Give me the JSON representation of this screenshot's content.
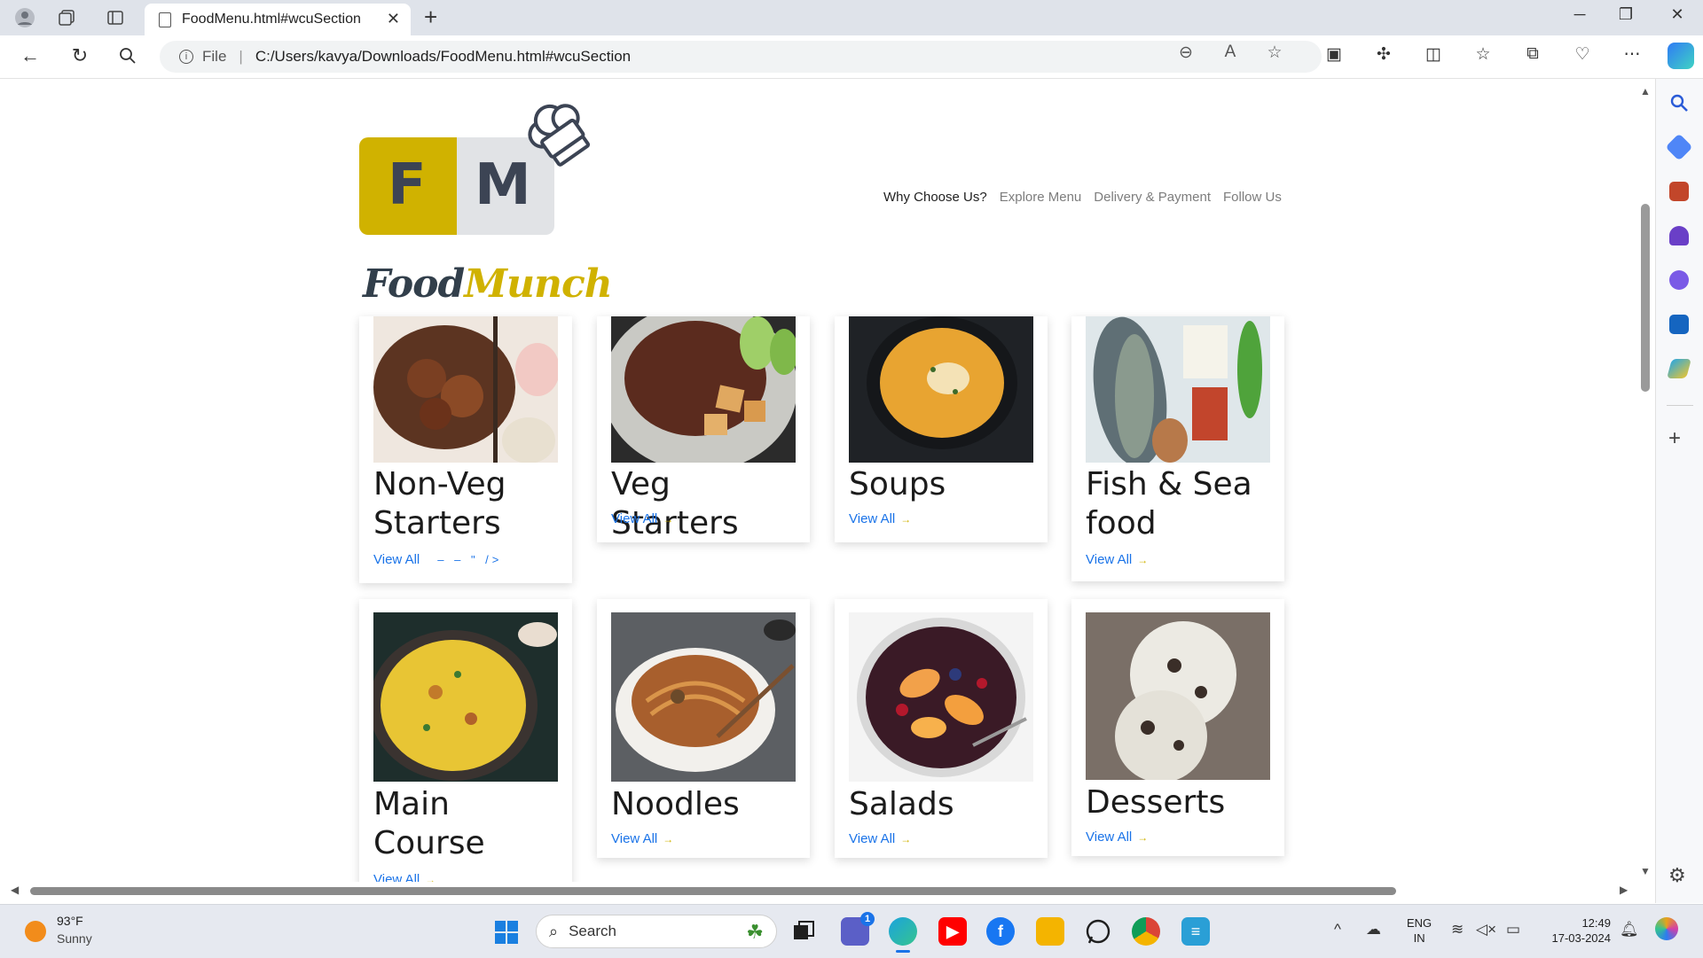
{
  "browser": {
    "tab_title": "FoodMenu.html#wcuSection",
    "address_scheme": "File",
    "address_url": "C:/Users/kavya/Downloads/FoodMenu.html#wcuSection"
  },
  "site": {
    "logo_letters": [
      "F",
      "M"
    ],
    "brand_part1": "Food",
    "brand_part2": "Munch",
    "nav": [
      {
        "label": "Why Choose Us?",
        "active": true
      },
      {
        "label": "Explore Menu",
        "active": false
      },
      {
        "label": "Delivery & Payment",
        "active": false
      },
      {
        "label": "Follow Us",
        "active": false
      }
    ]
  },
  "menu": {
    "cards": [
      {
        "title": "Non-Veg Starters",
        "link": "View All",
        "extra_text": "– – \" />"
      },
      {
        "title": "Veg Starters",
        "link": "View All"
      },
      {
        "title": "Soups",
        "link": "View All"
      },
      {
        "title": "Fish & Sea food",
        "link": "View All"
      },
      {
        "title": "Main Course",
        "link": "View All"
      },
      {
        "title": "Noodles",
        "link": "View All"
      },
      {
        "title": "Salads",
        "link": "View All"
      },
      {
        "title": "Desserts",
        "link": "View All"
      }
    ]
  },
  "taskbar": {
    "weather_temp": "93°F",
    "weather_desc": "Sunny",
    "search_label": "Search",
    "lang_line1": "ENG",
    "lang_line2": "IN",
    "time": "12:49",
    "date": "17-03-2024",
    "teams_badge": "1"
  },
  "colors": {
    "brand_yellow": "#d0b200",
    "brand_dark": "#323f4b",
    "link_blue": "#1a73e8"
  }
}
